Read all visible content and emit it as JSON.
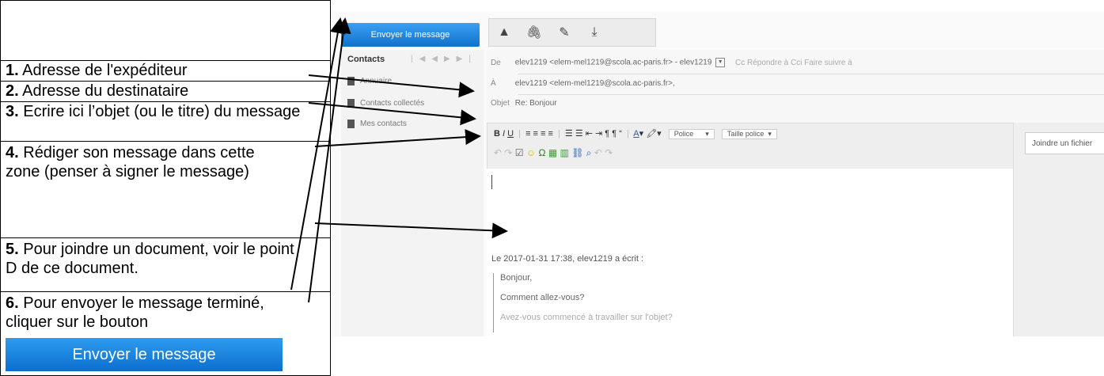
{
  "legend": {
    "items": [
      {
        "num": "1.",
        "text": " Adresse de l'expéditeur"
      },
      {
        "num": "2.",
        "text": " Adresse du destinataire"
      },
      {
        "num": "3.",
        "text": " Ecrire ici l’objet (ou le titre) du message"
      },
      {
        "num": "4.",
        "text": " Rédiger son message dans cette zone (penser à signer le message)"
      },
      {
        "num": "5.",
        "text": " Pour joindre un document, voir le point D de ce document."
      },
      {
        "num": "6.",
        "text": " Pour envoyer le message terminé, cliquer sur le bouton"
      }
    ],
    "send_button_label": "Envoyer le message"
  },
  "screenshot": {
    "send_button_label": "Envoyer le message",
    "toolbar_icons": [
      "reply-icon",
      "paperclip-icon",
      "pencil-icon",
      "download-icon"
    ],
    "sidebar": {
      "title": "Contacts",
      "items": [
        "Annuaire",
        "Contacts collectés",
        "Mes contacts"
      ]
    },
    "headers": {
      "from_label": "De",
      "from_value": "elev1219 <elem-mel1219@scola.ac-paris.fr> - elev1219",
      "from_options": "Cc   Répondre à   Cci   Faire suivre à",
      "to_label": "À",
      "to_value": "elev1219 <elem-mel1219@scola.ac-paris.fr>,",
      "subject_label": "Objet",
      "subject_value": "Re: Bonjour"
    },
    "editor": {
      "font_label": "Police",
      "size_label": "Taille police"
    },
    "attach_button_label": "Joindre un fichier",
    "body": {
      "quote_header": "Le 2017-01-31 17:38, elev1219 a écrit :",
      "quote_lines": [
        "Bonjour,",
        "Comment allez-vous?",
        "Avez-vous commencé à travailler sur l'objet?"
      ]
    }
  }
}
